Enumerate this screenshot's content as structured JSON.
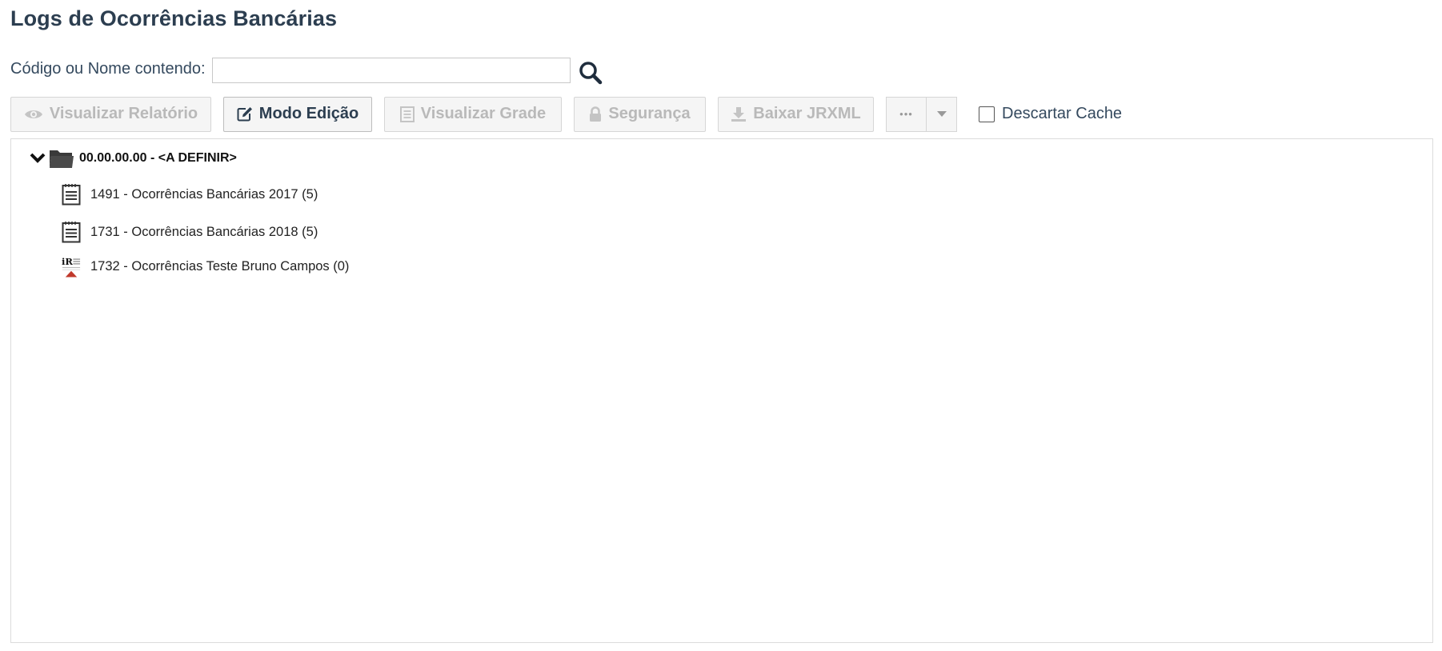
{
  "page": {
    "title": "Logs de Ocorrências Bancárias"
  },
  "search": {
    "label": "Código ou Nome contendo:",
    "value": "",
    "placeholder": ""
  },
  "toolbar": {
    "view_report_label": "Visualizar Relatório",
    "edit_mode_label": "Modo Edição",
    "view_grid_label": "Visualizar Grade",
    "security_label": "Segurança",
    "download_jrxml_label": "Baixar JRXML",
    "more_label": "•••",
    "discard_cache_label": "Descartar Cache",
    "discard_cache_checked": false
  },
  "tree": {
    "root": {
      "label": "00.00.00.00 - <A DEFINIR>",
      "expanded": true,
      "icon": "folder-open-icon"
    },
    "items": [
      {
        "label": "1491 - Ocorrências Bancárias 2017 (5)",
        "icon": "report-list-icon"
      },
      {
        "label": "1731 - Ocorrências Bancárias 2018 (5)",
        "icon": "report-list-icon"
      },
      {
        "label": "1732 - Ocorrências Teste Bruno Campos (0)",
        "icon": "ireport-icon"
      }
    ]
  },
  "colors": {
    "title": "#2c3e50",
    "disabled_text": "#b9b9b9",
    "border": "#dcdcdc",
    "icon_dark": "#1f2d3d"
  }
}
